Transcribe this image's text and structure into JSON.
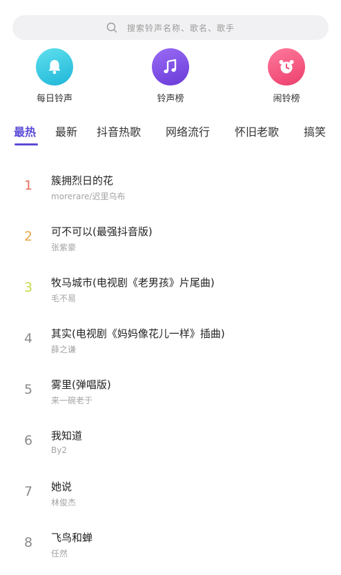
{
  "search": {
    "placeholder": "搜索铃声名称、歌名、歌手"
  },
  "shortcuts": [
    {
      "label": "每日铃声",
      "icon": "bell-icon",
      "color": "#2cc6e0"
    },
    {
      "label": "铃声榜",
      "icon": "music-note-icon",
      "color": "#7b4be8"
    },
    {
      "label": "闹铃榜",
      "icon": "alarm-clock-icon",
      "color": "#f0507a"
    }
  ],
  "tabs": [
    "最热",
    "最新",
    "抖音热歌",
    "网络流行",
    "怀旧老歌",
    "搞笑"
  ],
  "active_tab": "最热",
  "colors": {
    "accent": "#5b4bd6",
    "rank_1": "#e8705f",
    "rank_2": "#e8a64a",
    "rank_3": "#c7d94a",
    "rank_default": "#8a8a8a"
  },
  "songs": [
    {
      "rank": "1",
      "title": "簇拥烈日的花",
      "artist": "morerare/迟里乌布"
    },
    {
      "rank": "2",
      "title": "可不可以(最强抖音版)",
      "artist": "张紫豪"
    },
    {
      "rank": "3",
      "title": "牧马城市(电视剧《老男孩》片尾曲)",
      "artist": "毛不易"
    },
    {
      "rank": "4",
      "title": "其实(电视剧《妈妈像花儿一样》插曲)",
      "artist": "薛之谦"
    },
    {
      "rank": "5",
      "title": "雾里(弹唱版)",
      "artist": "来一碗老于"
    },
    {
      "rank": "6",
      "title": "我知道",
      "artist": "By2"
    },
    {
      "rank": "7",
      "title": "她说",
      "artist": "林俊杰"
    },
    {
      "rank": "8",
      "title": "飞鸟和蝉",
      "artist": "任然"
    }
  ]
}
